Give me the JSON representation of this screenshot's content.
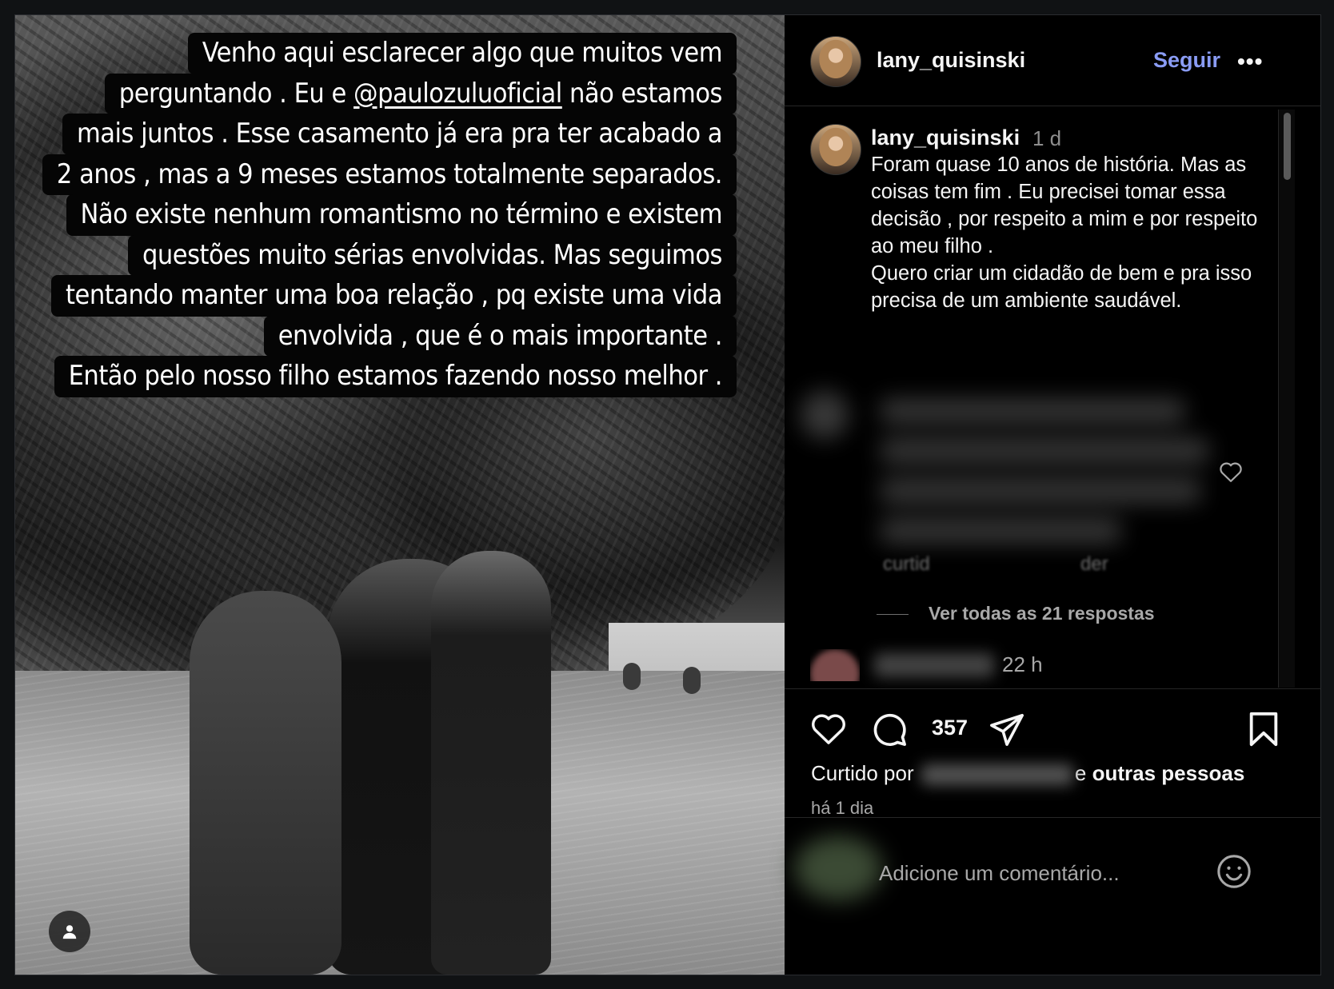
{
  "story": {
    "lines": [
      "Venho aqui esclarecer algo que muitos vem",
      "perguntando . Eu e ",
      "@paulozuluoficial",
      " não estamos",
      "mais juntos . Esse casamento já era pra ter acabado a",
      "2 anos , mas a 9 meses estamos totalmente separados.",
      "Não existe nenhum romantismo no término e existem",
      "questões muito sérias envolvidas. Mas seguimos",
      "tentando manter uma boa relação , pq existe uma vida",
      "envolvida , que é o mais importante .",
      "Então  pelo nosso filho estamos fazendo nosso melhor ."
    ]
  },
  "header": {
    "username": "lany_quisinski",
    "follow_label": "Seguir",
    "more_label": "•••"
  },
  "caption": {
    "username": "lany_quisinski",
    "time": "1 d",
    "text": "Foram quase 10 anos de história. Mas as coisas tem fim . Eu precisei tomar essa decisão , por respeito a mim e por respeito ao meu filho .\nQuero criar um cidadão de bem e pra isso precisa de um ambiente saudável."
  },
  "comments": {
    "partial_likes": "curtid",
    "partial_reply": "der",
    "view_replies": "Ver todas as 21 respostas",
    "next_time": "22 h"
  },
  "actions": {
    "comment_count": "357",
    "liked_prefix": "Curtido por",
    "liked_suffix_e": "e",
    "liked_suffix": "outras pessoas",
    "date": "há 1 dia"
  },
  "comment_input": {
    "placeholder": "Adicione um comentário..."
  },
  "icons": {
    "like": "heart-icon",
    "comment": "comment-bubble-icon",
    "share": "paper-plane-icon",
    "save": "bookmark-icon",
    "emoji": "smiley-icon",
    "user_tag": "user-icon"
  },
  "colors": {
    "follow": "#8a9cf5",
    "background": "#000000",
    "secondary_text": "#a8a8a8"
  }
}
